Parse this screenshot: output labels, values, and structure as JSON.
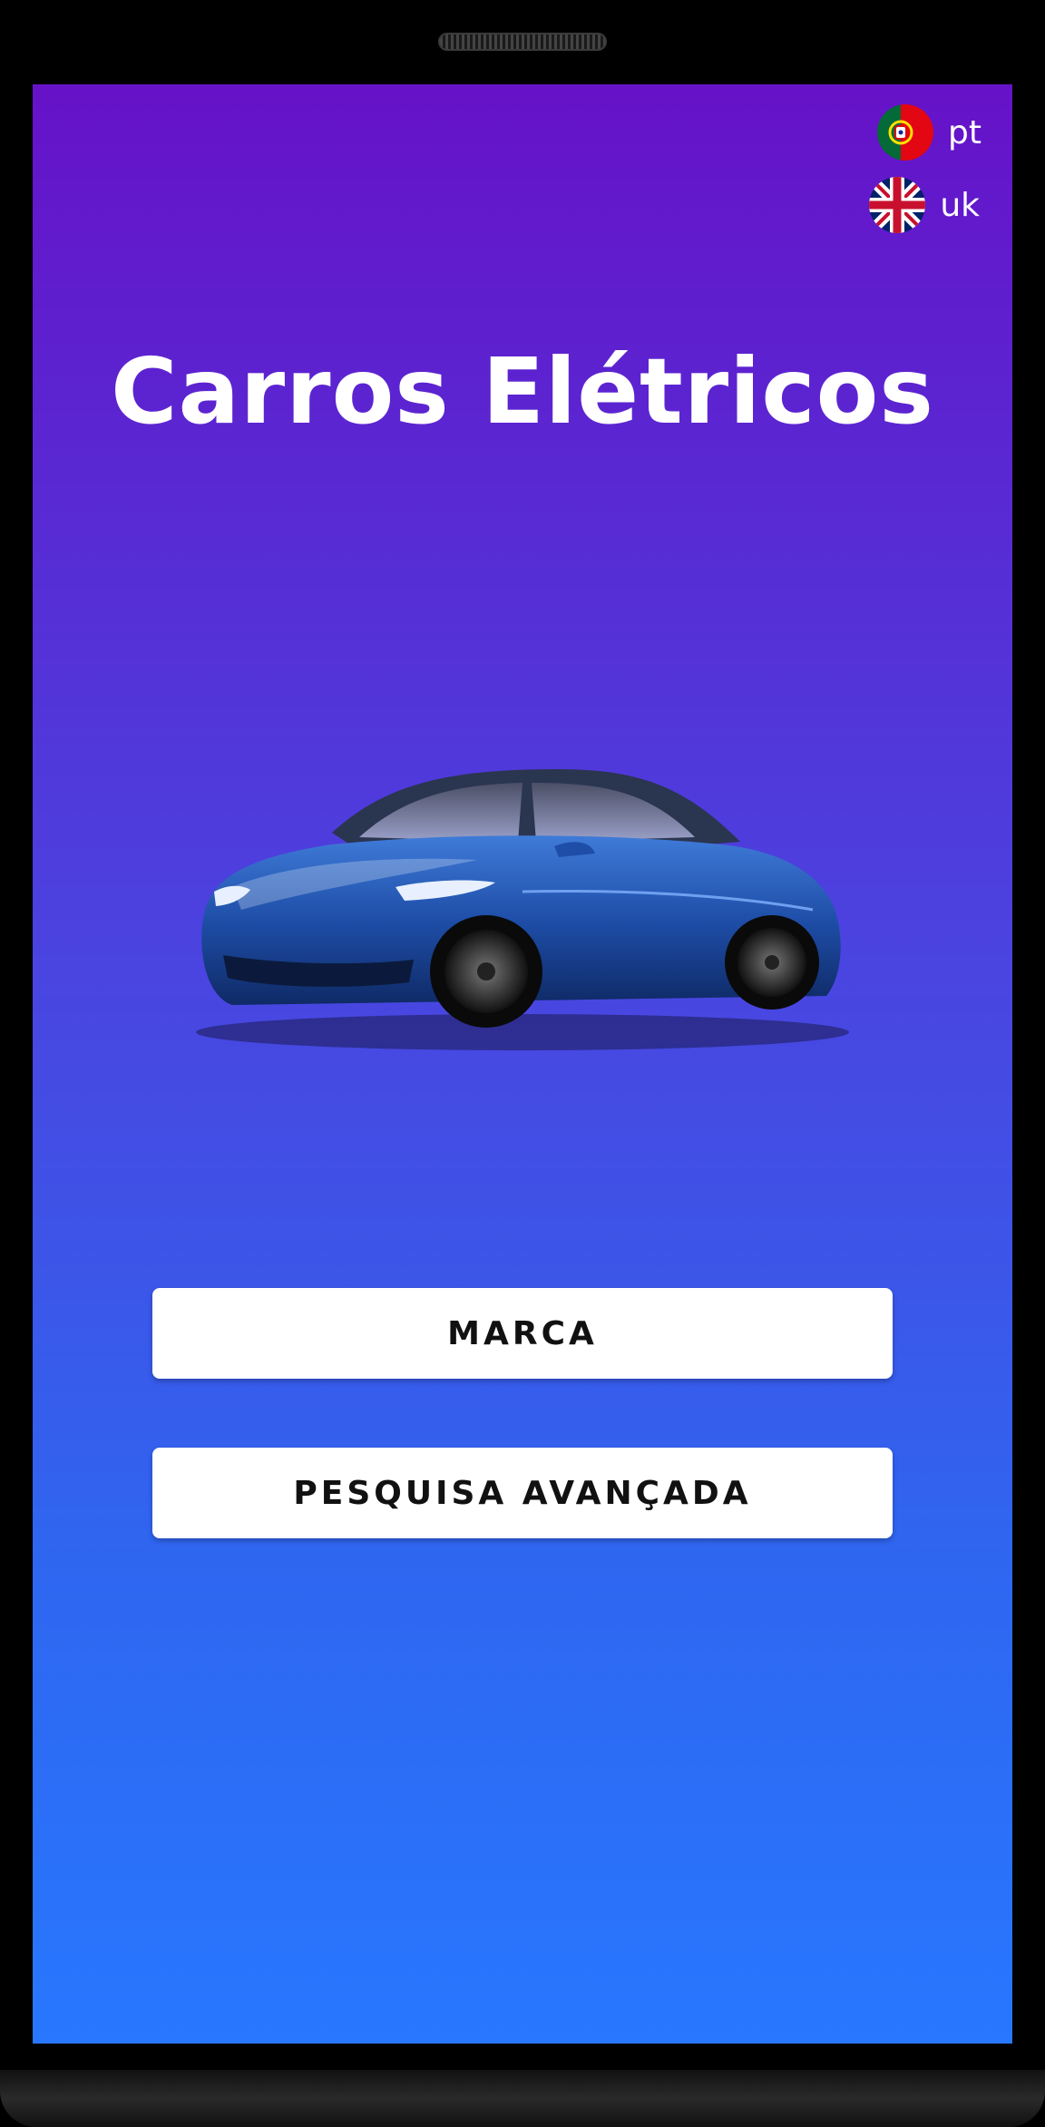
{
  "app": {
    "title": "Carros Elétricos"
  },
  "languages": [
    {
      "code": "pt",
      "label": "pt",
      "flag_icon": "portugal-flag-icon"
    },
    {
      "code": "uk",
      "label": "uk",
      "flag_icon": "uk-flag-icon"
    }
  ],
  "image": {
    "semantic": "electric-car-illustration"
  },
  "buttons": {
    "marca": "MARCA",
    "pesquisa": "PESQUISA AVANÇADA"
  },
  "colors": {
    "gradient_top": "#6612c8",
    "gradient_bottom": "#2877fe",
    "button_bg": "#ffffff",
    "button_text": "#111111",
    "car_body": "#1e4ea8"
  }
}
